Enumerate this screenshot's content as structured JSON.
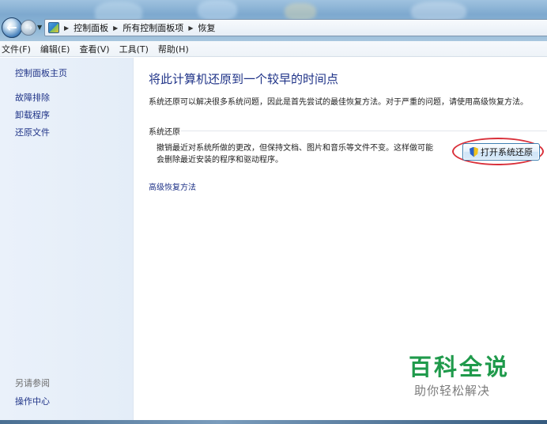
{
  "breadcrumb": {
    "items": [
      "控制面板",
      "所有控制面板项",
      "恢复"
    ]
  },
  "menu": {
    "items": [
      "文件(F)",
      "编辑(E)",
      "查看(V)",
      "工具(T)",
      "帮助(H)"
    ]
  },
  "sidebar": {
    "home": "控制面板主页",
    "links": [
      "故障排除",
      "卸载程序",
      "还原文件"
    ],
    "see_also_title": "另请参阅",
    "see_also_links": [
      "操作中心"
    ]
  },
  "main": {
    "title": "将此计算机还原到一个较早的时间点",
    "description": "系统还原可以解决很多系统问题，因此是首先尝试的最佳恢复方法。对于严重的问题，请使用高级恢复方法。",
    "section_title": "系统还原",
    "section_text_line1": "撤销最近对系统所做的更改，但保持文档、图片和音乐等文件不变。这样做可能",
    "section_text_line2": "会删除最近安装的程序和驱动程序。",
    "restore_button": "打开系统还原",
    "advanced_link": "高级恢复方法"
  },
  "watermark": {
    "title": "百科全说",
    "subtitle": "助你轻松解决"
  },
  "colors": {
    "link": "#1e3287",
    "annotation": "#d9303a",
    "watermark": "#1f9a4b"
  }
}
